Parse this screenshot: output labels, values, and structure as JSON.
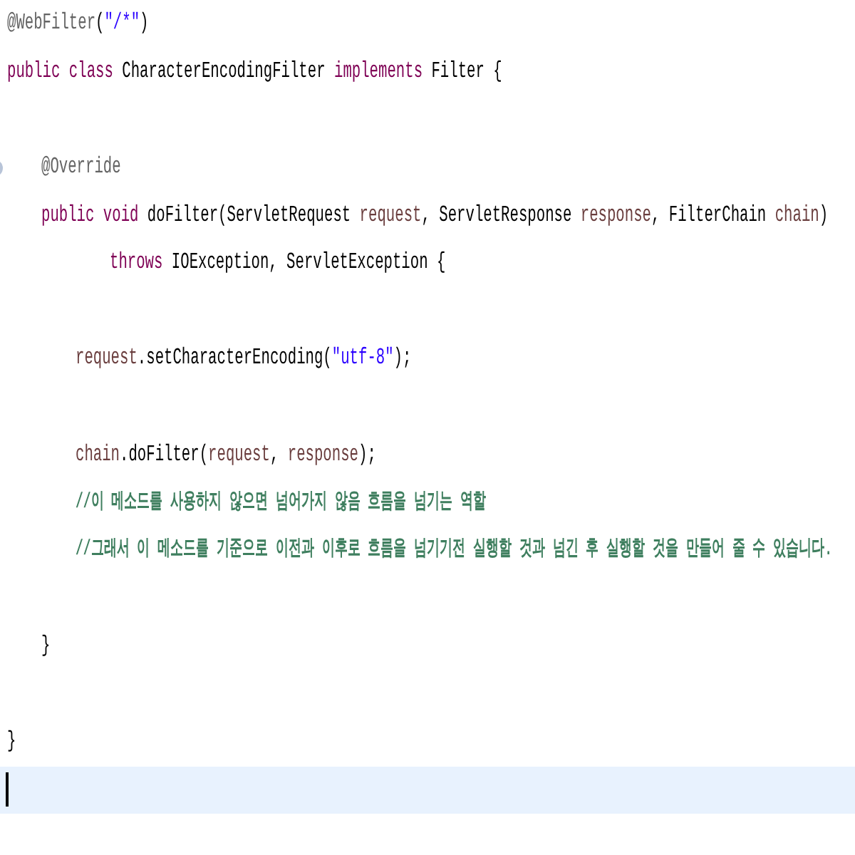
{
  "editor": {
    "lines": [
      {
        "kind": "code",
        "tokens": [
          {
            "kind": "annotation",
            "text": "@WebFilter"
          },
          {
            "kind": "plain",
            "text": "("
          },
          {
            "kind": "string",
            "text": "\"/*\""
          },
          {
            "kind": "plain",
            "text": ")"
          }
        ]
      },
      {
        "kind": "code",
        "tokens": [
          {
            "kind": "keyword",
            "text": "public"
          },
          {
            "kind": "keyword",
            "text": " class"
          },
          {
            "kind": "plain",
            "text": " CharacterEncodingFilter "
          },
          {
            "kind": "keyword",
            "text": "implements"
          },
          {
            "kind": "plain",
            "text": " Filter {"
          }
        ],
        "children": [
          {
            "kind": "blank"
          },
          {
            "kind": "code",
            "override_marker": true,
            "tokens": [
              {
                "kind": "annotation",
                "text": "@Override"
              }
            ]
          },
          {
            "kind": "code",
            "tokens": [
              {
                "kind": "keyword",
                "text": "public"
              },
              {
                "kind": "keyword",
                "text": " void"
              },
              {
                "kind": "plain",
                "text": " doFilter(ServletRequest "
              },
              {
                "kind": "param",
                "text": "request"
              },
              {
                "kind": "plain",
                "text": ", ServletResponse "
              },
              {
                "kind": "param",
                "text": "response"
              },
              {
                "kind": "plain",
                "text": ", FilterChain "
              },
              {
                "kind": "param",
                "text": "chain"
              },
              {
                "kind": "plain",
                "text": ")"
              }
            ],
            "children": [
              {
                "kind": "continuation",
                "tokens": [
                  {
                    "kind": "keyword",
                    "text": "throws"
                  },
                  {
                    "kind": "plain",
                    "text": " IOException, ServletException {"
                  }
                ]
              },
              {
                "kind": "blank"
              },
              {
                "kind": "code",
                "tokens": [
                  {
                    "kind": "param",
                    "text": "request"
                  },
                  {
                    "kind": "plain",
                    "text": ".setCharacterEncoding("
                  },
                  {
                    "kind": "string",
                    "text": "\"utf-8\""
                  },
                  {
                    "kind": "plain",
                    "text": ");"
                  }
                ]
              },
              {
                "kind": "blank"
              },
              {
                "kind": "code",
                "tokens": [
                  {
                    "kind": "param",
                    "text": "chain"
                  },
                  {
                    "kind": "plain",
                    "text": ".doFilter("
                  },
                  {
                    "kind": "param",
                    "text": "request"
                  },
                  {
                    "kind": "plain",
                    "text": ", "
                  },
                  {
                    "kind": "param",
                    "text": "response"
                  },
                  {
                    "kind": "plain",
                    "text": ");"
                  }
                ]
              },
              {
                "kind": "code",
                "tokens": [
                  {
                    "kind": "comment",
                    "text": "//이 메소드를 사용하지 않으면 넘어가지 않음 흐름을 넘기는 역할"
                  }
                ]
              },
              {
                "kind": "code",
                "tokens": [
                  {
                    "kind": "comment",
                    "text": "//그래서 이 메소드를 기준으로 이전과 이후로 흐름을 넘기기전 실행할 것과 넘긴 후 실행할 것을 만들어 줄 수 있습니다."
                  }
                ]
              },
              {
                "kind": "blank"
              }
            ]
          },
          {
            "kind": "code",
            "tokens": [
              {
                "kind": "plain",
                "text": "}"
              }
            ]
          },
          {
            "kind": "blank"
          }
        ]
      },
      {
        "kind": "code",
        "tokens": [
          {
            "kind": "plain",
            "text": "}"
          }
        ]
      },
      {
        "kind": "blank",
        "current": true
      }
    ]
  }
}
